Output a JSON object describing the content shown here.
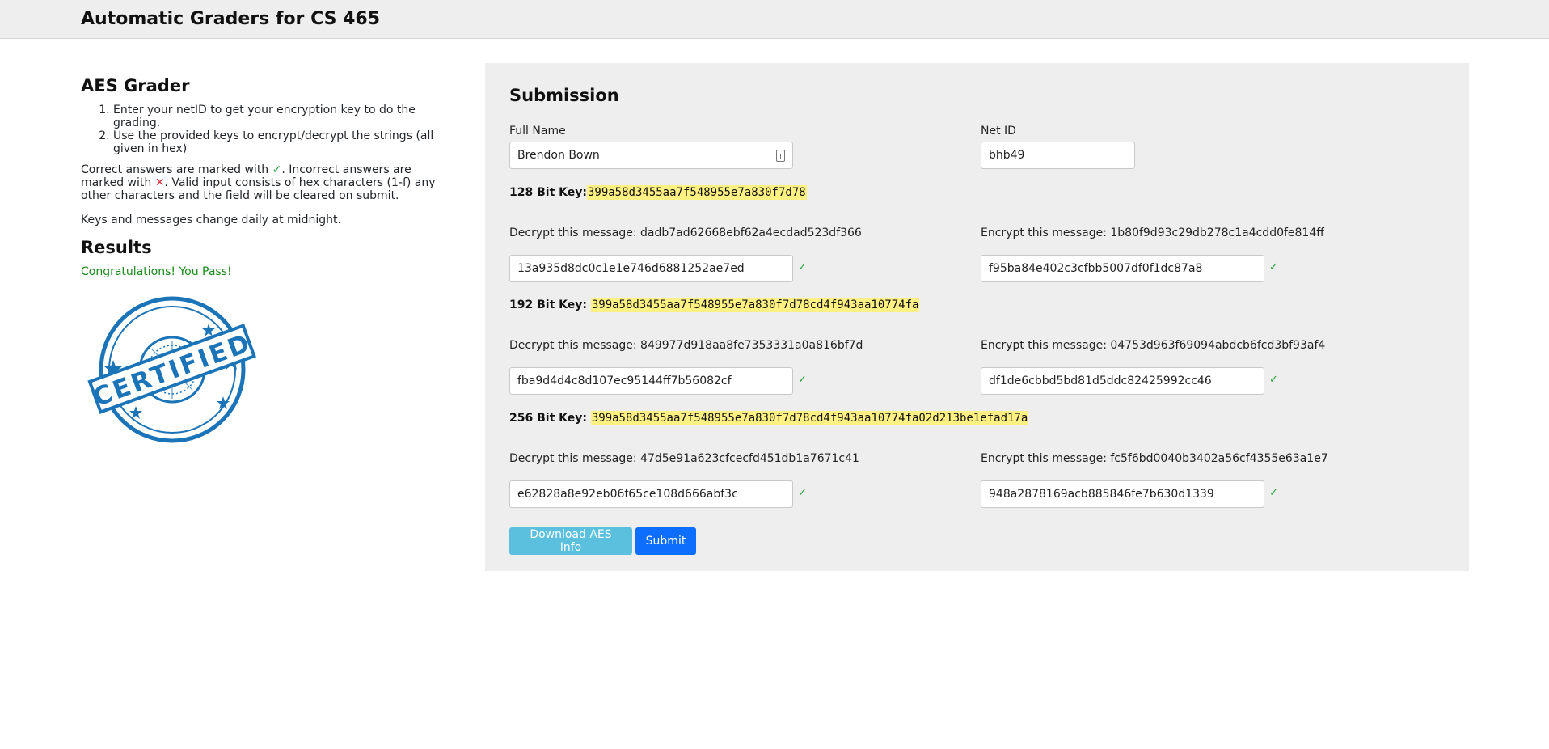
{
  "header": {
    "title": "Automatic Graders for CS 465"
  },
  "info": {
    "title": "AES Grader",
    "steps": [
      "Enter your netID to get your encryption key to do the grading.",
      "Use the provided keys to encrypt/decrypt the strings (all given in hex)"
    ],
    "marks_pre": "Correct answers are marked with ",
    "check_glyph": "✓",
    "marks_mid": ". Incorrect answers are marked with ",
    "cross_glyph": "✕",
    "marks_post": ". Valid input consists of hex characters (1-f) any other characters and the field will be cleared on submit.",
    "daily_note": "Keys and messages change daily at midnight."
  },
  "results": {
    "title": "Results",
    "message": "Congratulations! You Pass!",
    "stamp_text": "CERTIFIED"
  },
  "submission": {
    "title": "Submission",
    "full_name_label": "Full Name",
    "full_name_value": "Brendon Bown",
    "net_id_label": "Net ID",
    "net_id_value": "bhb49",
    "keys": [
      {
        "label": "128 Bit Key:",
        "value": "399a58d3455aa7f548955e7a830f7d78",
        "decrypt_prompt": "Decrypt this message: dadb7ad62668ebf62a4ecdad523df366",
        "decrypt_answer": "13a935d8dc0c1e1e746d6881252ae7ed",
        "encrypt_prompt": "Encrypt this message: 1b80f9d93c29db278c1a4cdd0fe814ff",
        "encrypt_answer": "f95ba84e402c3cfbb5007df0f1dc87a8"
      },
      {
        "label": "192 Bit Key: ",
        "value": "399a58d3455aa7f548955e7a830f7d78cd4f943aa10774fa",
        "decrypt_prompt": "Decrypt this message: 849977d918aa8fe7353331a0a816bf7d",
        "decrypt_answer": "fba9d4d4c8d107ec95144ff7b56082cf",
        "encrypt_prompt": "Encrypt this message: 04753d963f69094abdcb6fcd3bf93af4",
        "encrypt_answer": "df1de6cbbd5bd81d5ddc82425992cc46"
      },
      {
        "label": "256 Bit Key: ",
        "value": "399a58d3455aa7f548955e7a830f7d78cd4f943aa10774fa02d213be1efad17a",
        "decrypt_prompt": "Decrypt this message: 47d5e91a623cfcecfd451db1a7671c41",
        "decrypt_answer": "e62828a8e92eb06f65ce108d666abf3c",
        "encrypt_prompt": "Encrypt this message: fc5f6bd0040b3402a56cf4355e63a1e7",
        "encrypt_answer": "948a2878169acb885846fe7b630d1339"
      }
    ],
    "download_label": "Download AES Info",
    "submit_label": "Submit"
  },
  "colors": {
    "key_highlight": "#fdf183",
    "check": "#22a33a",
    "pass": "#1a8a1a",
    "stamp": "#1b74b8",
    "download_button": "#5bc0de",
    "submit_button": "#0d6efd"
  },
  "icons": [
    "check-icon",
    "cross-icon",
    "autofill-icon",
    "certified-stamp-icon"
  ]
}
